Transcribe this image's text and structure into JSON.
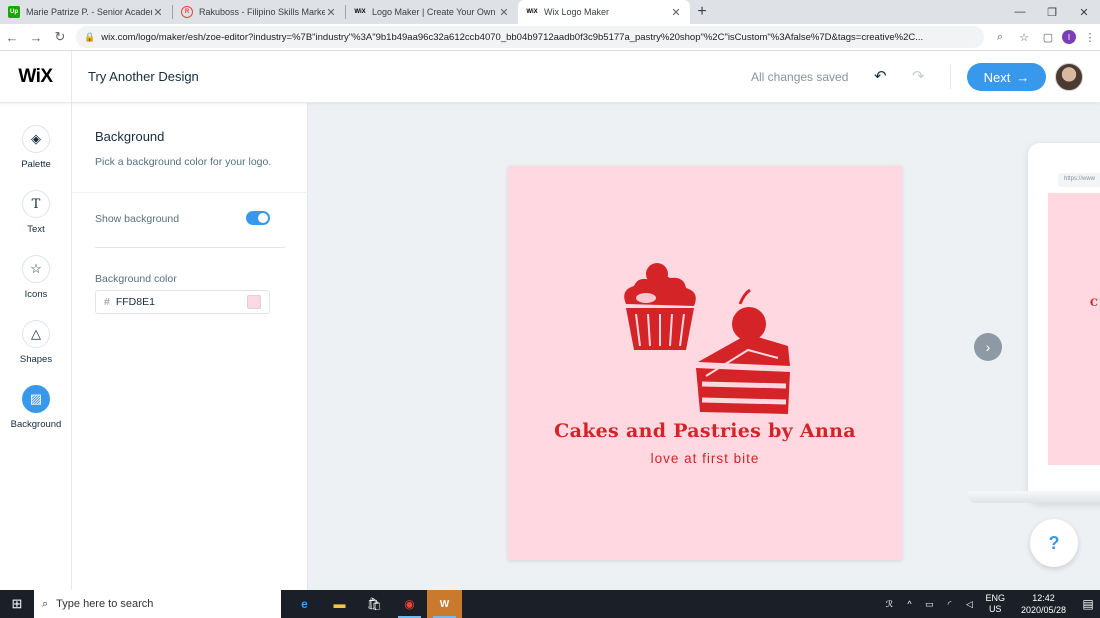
{
  "browser": {
    "tabs": [
      {
        "favicon": "Up",
        "favicon_color": "#14a800",
        "title": "Marie Patrize P. - Senior Academ",
        "active": false
      },
      {
        "favicon": "R",
        "favicon_color": "#e8443a",
        "title": "Rakuboss - Filipino Skills Marketp",
        "active": false
      },
      {
        "favicon": "WiX",
        "favicon_color": "#000000",
        "title": "Logo Maker | Create Your Own Fr",
        "active": false
      },
      {
        "favicon": "WiX",
        "favicon_color": "#000000",
        "title": "Wix Logo Maker",
        "active": true
      }
    ],
    "url": "wix.com/logo/maker/esh/zoe-editor?industry=%7B\"industry\"%3A\"9b1b49aa96c32a612ccb4070_bb04b9712aadb0f3c9b5177a_pastry%20shop\"%2C\"isCustom\"%3Afalse%7D&tags=creative%2C...",
    "profile_initial": "I"
  },
  "header": {
    "logo": "WiX",
    "try_another": "Try Another Design",
    "status": "All changes saved",
    "next_label": "Next",
    "next_arrow": "→"
  },
  "rail": {
    "items": [
      {
        "label": "Palette",
        "icon": "palette-icon",
        "glyph": "◈"
      },
      {
        "label": "Text",
        "icon": "text-icon",
        "glyph": "T"
      },
      {
        "label": "Icons",
        "icon": "star-icon",
        "glyph": "☆"
      },
      {
        "label": "Shapes",
        "icon": "shapes-icon",
        "glyph": "△"
      },
      {
        "label": "Background",
        "icon": "background-icon",
        "glyph": "▨"
      }
    ]
  },
  "panel": {
    "title": "Background",
    "subtitle": "Pick a background color for your logo.",
    "show_background_label": "Show background",
    "show_background": true,
    "bg_color_label": "Background color",
    "hash": "#",
    "bg_color_value": "FFD8E1"
  },
  "canvas": {
    "logo_bg": "#ffd8e1",
    "logo_color": "#d42428",
    "logo_name": "Cakes and Pastries by Anna",
    "tagline": "love at first bite",
    "preview_url": "https://www",
    "preview_letter": "C",
    "help": "?"
  },
  "taskbar": {
    "search_placeholder": "Type here to search",
    "lang": "ENG",
    "region": "US",
    "time": "12:42",
    "date": "2020/05/28"
  }
}
